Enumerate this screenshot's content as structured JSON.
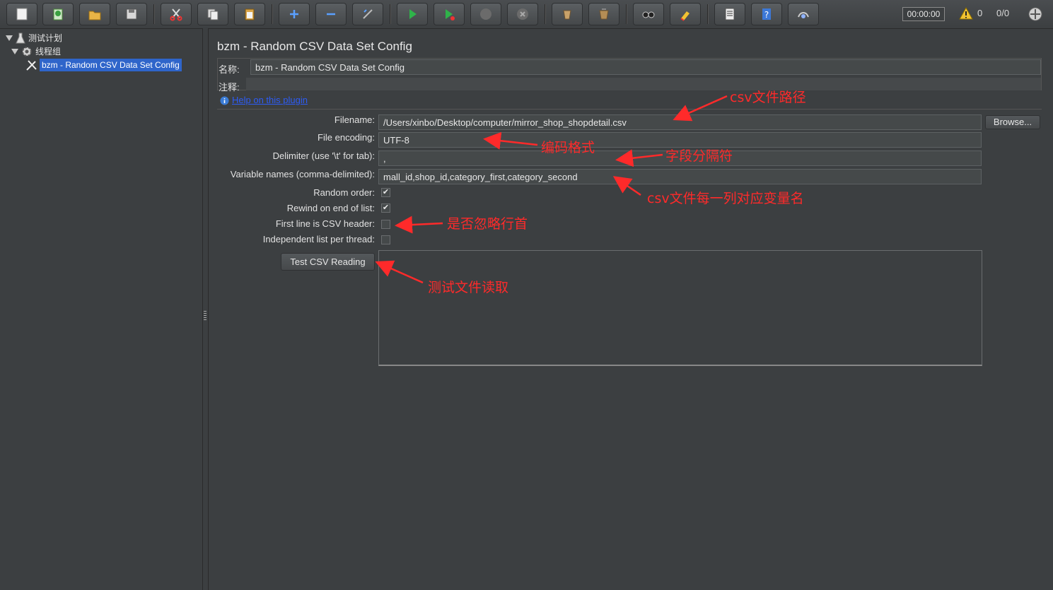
{
  "toolbar": {
    "buttons": [
      {
        "name": "new-icon"
      },
      {
        "name": "templates-icon"
      },
      {
        "name": "open-icon"
      },
      {
        "name": "save-icon"
      },
      {
        "name": "cut-icon"
      },
      {
        "name": "copy-icon"
      },
      {
        "name": "paste-icon"
      },
      {
        "name": "expand-icon"
      },
      {
        "name": "collapse-icon"
      },
      {
        "name": "toggle-icon"
      },
      {
        "name": "start-icon"
      },
      {
        "name": "start-no-pause-icon"
      },
      {
        "name": "stop-icon"
      },
      {
        "name": "shutdown-icon"
      },
      {
        "name": "clear-icon"
      },
      {
        "name": "clear-all-icon"
      },
      {
        "name": "search-icon"
      },
      {
        "name": "reset-search-icon"
      },
      {
        "name": "function-helper-icon"
      },
      {
        "name": "help-icon"
      },
      {
        "name": "remote-icon"
      }
    ],
    "timer": "00:00:00",
    "warning_count": "0",
    "threads": "0/0"
  },
  "tree": {
    "items": [
      {
        "label": "测试计划"
      },
      {
        "label": "线程组"
      },
      {
        "label": "bzm - Random CSV Data Set Config"
      }
    ]
  },
  "panel": {
    "title": "bzm - Random CSV Data Set Config",
    "name_label": "名称:",
    "name_value": "bzm - Random CSV Data Set Config",
    "comment_label": "注释:",
    "comment_value": "",
    "help_link": "Help on this plugin",
    "filename_label": "Filename:",
    "filename_value": "/Users/xinbo/Desktop/computer/mirror_shop_shopdetail.csv",
    "browse_label": "Browse...",
    "encoding_label": "File encoding:",
    "encoding_value": "UTF-8",
    "delimiter_label": "Delimiter (use '\\t' for tab):",
    "delimiter_value": ",",
    "varnames_label": "Variable names (comma-delimited):",
    "varnames_value": "mall_id,shop_id,category_first,category_second",
    "random_order_label": "Random order:",
    "random_order_checked": true,
    "rewind_label": "Rewind on end of list:",
    "rewind_checked": true,
    "first_line_label": "First line is CSV header:",
    "first_line_checked": false,
    "independent_label": "Independent list per thread:",
    "independent_checked": false,
    "test_button_label": "Test CSV Reading",
    "test_output": ""
  },
  "annotations": {
    "csv_path": "csv文件路径",
    "encoding": "编码格式",
    "delimiter": "字段分隔符",
    "varnames": "csv文件每一列对应变量名",
    "header": "是否忽略行首",
    "test": "测试文件读取"
  },
  "colors": {
    "annotation": "#ff2a2a",
    "selection": "#2f65ca",
    "link": "#2d5cf6",
    "background": "#3c3f41"
  }
}
